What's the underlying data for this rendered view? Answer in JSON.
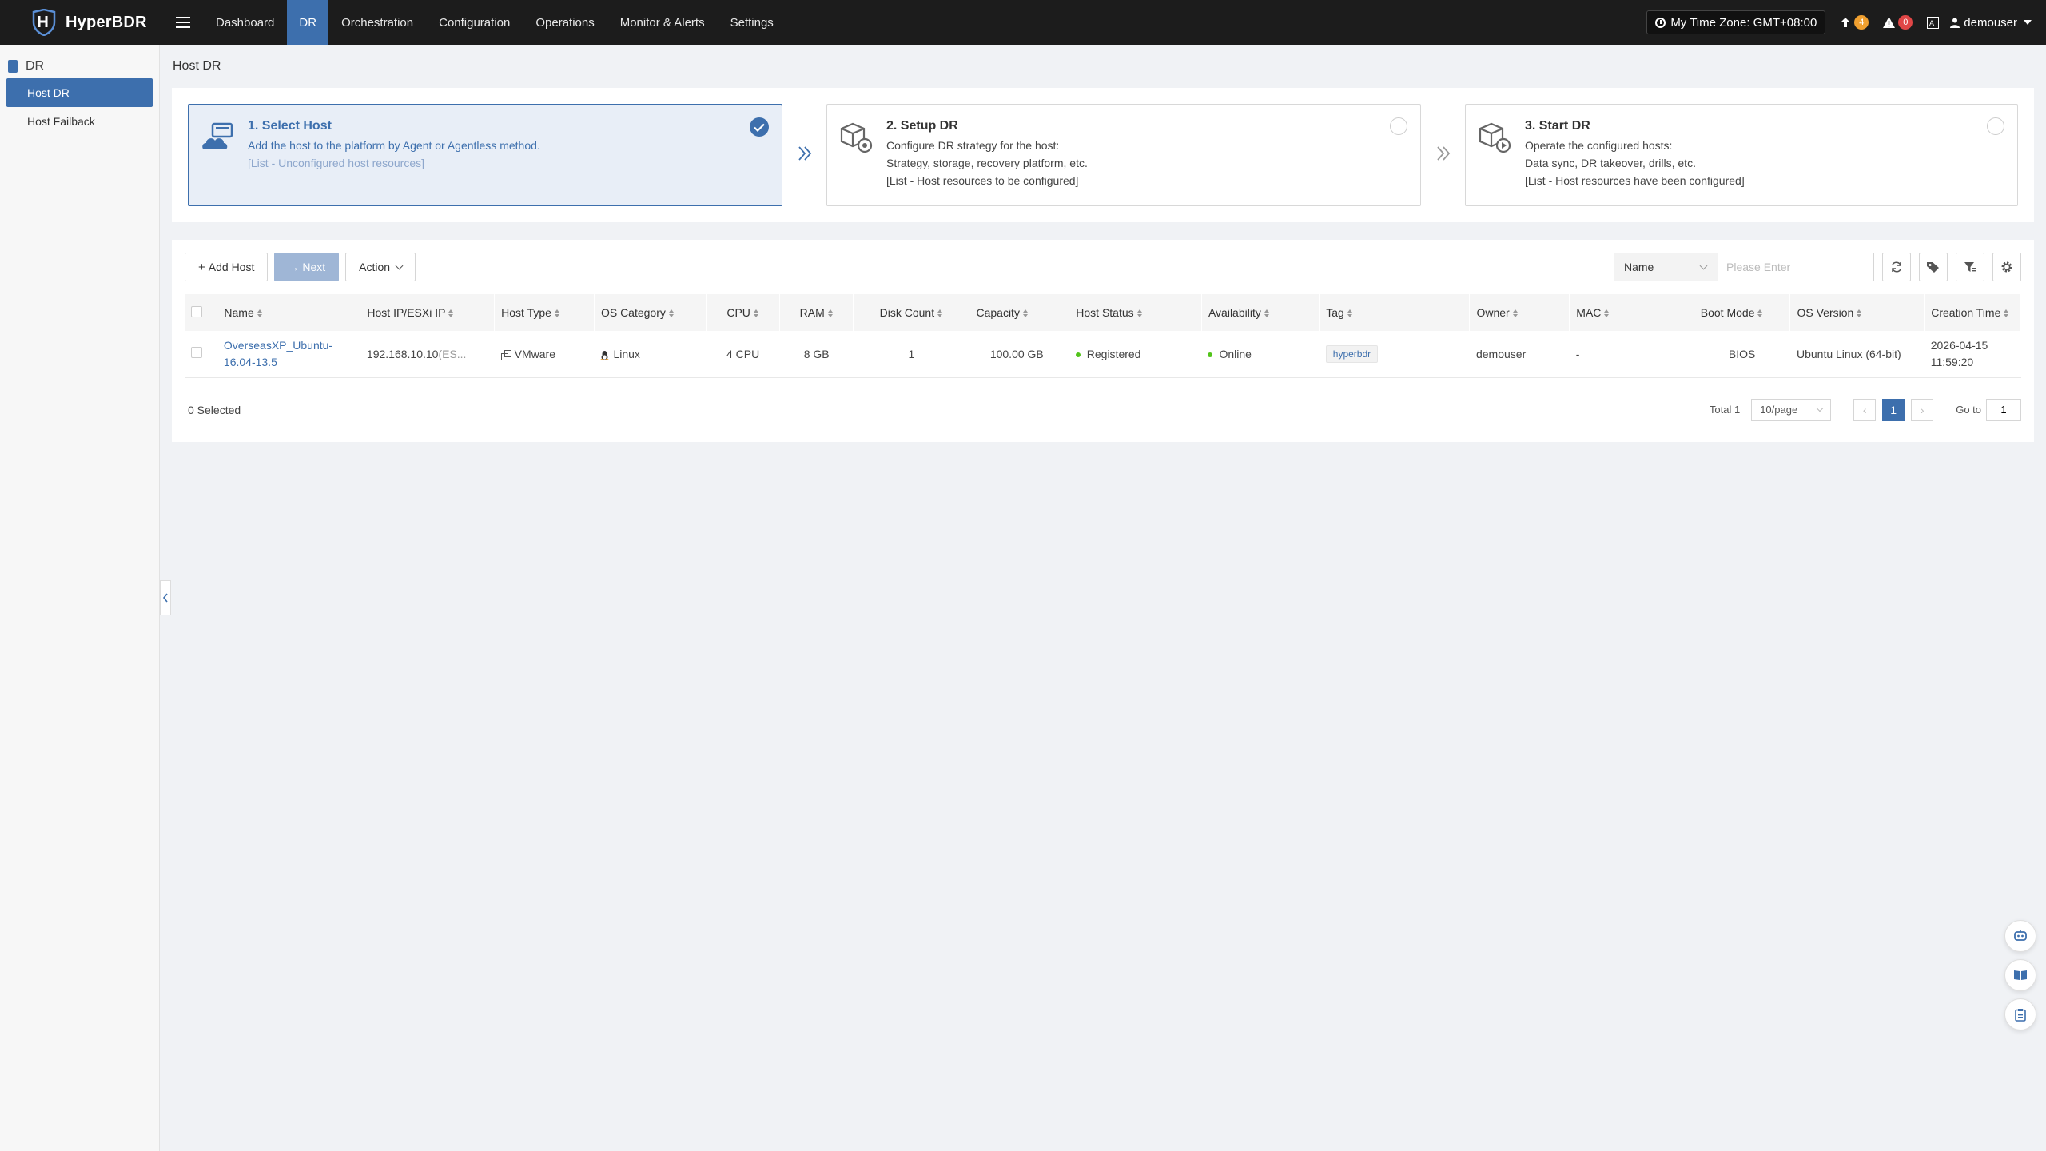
{
  "app": {
    "name": "HyperBDR"
  },
  "nav": {
    "items": [
      {
        "label": "Dashboard"
      },
      {
        "label": "DR"
      },
      {
        "label": "Orchestration"
      },
      {
        "label": "Configuration"
      },
      {
        "label": "Operations"
      },
      {
        "label": "Monitor & Alerts"
      },
      {
        "label": "Settings"
      }
    ],
    "active": "DR"
  },
  "header": {
    "timezone": "My Time Zone: GMT+08:00",
    "upload_count": "4",
    "alert_count": "0",
    "user": "demouser"
  },
  "sidebar": {
    "section": "DR",
    "items": [
      {
        "label": "Host DR"
      },
      {
        "label": "Host Failback"
      }
    ]
  },
  "page": {
    "title": "Host DR"
  },
  "steps": [
    {
      "title": "1. Select Host",
      "lines": [
        "Add the host to the platform by Agent or Agentless method.",
        "[List - Unconfigured host resources]"
      ]
    },
    {
      "title": "2. Setup DR",
      "lines": [
        "Configure DR strategy for the host:",
        "Strategy, storage, recovery platform, etc.",
        "[List - Host resources to be configured]"
      ]
    },
    {
      "title": "3. Start DR",
      "lines": [
        "Operate the configured hosts:",
        "Data sync, DR takeover, drills, etc.",
        "[List - Host resources have been configured]"
      ]
    }
  ],
  "toolbar": {
    "add_host": "Add Host",
    "next": "Next",
    "action": "Action",
    "filter_field": "Name",
    "search_placeholder": "Please Enter"
  },
  "table": {
    "columns": [
      "Name",
      "Host IP/ESXi IP",
      "Host Type",
      "OS Category",
      "CPU",
      "RAM",
      "Disk Count",
      "Capacity",
      "Host Status",
      "Availability",
      "Tag",
      "Owner",
      "MAC",
      "Boot Mode",
      "OS Version",
      "Creation Time"
    ],
    "rows": [
      {
        "name_line1": "OverseasXP_Ubuntu-",
        "name_line2": "16.04-13.5",
        "ip": "192.168.10.10",
        "ip_suffix": "(ES...",
        "host_type": "VMware",
        "os_category": "Linux",
        "cpu": "4 CPU",
        "ram": "8 GB",
        "disk_count": "1",
        "capacity": "100.00 GB",
        "host_status": "Registered",
        "availability": "Online",
        "tag": "hyperbdr",
        "owner": "demouser",
        "mac": "-",
        "boot_mode": "BIOS",
        "os_version": "Ubuntu Linux (64-bit)",
        "created_date": "2026-04-15",
        "created_time": "11:59:20"
      }
    ]
  },
  "footer": {
    "selected": "0 Selected",
    "total": "Total 1",
    "page_size": "10/page",
    "current_page": "1",
    "goto_label": "Go to",
    "goto_value": "1"
  },
  "colors": {
    "accent": "#3d6fad",
    "topbar": "#1c1c1c",
    "online": "#52c41a",
    "badge_orange": "#f0a030",
    "badge_red": "#e04646"
  }
}
